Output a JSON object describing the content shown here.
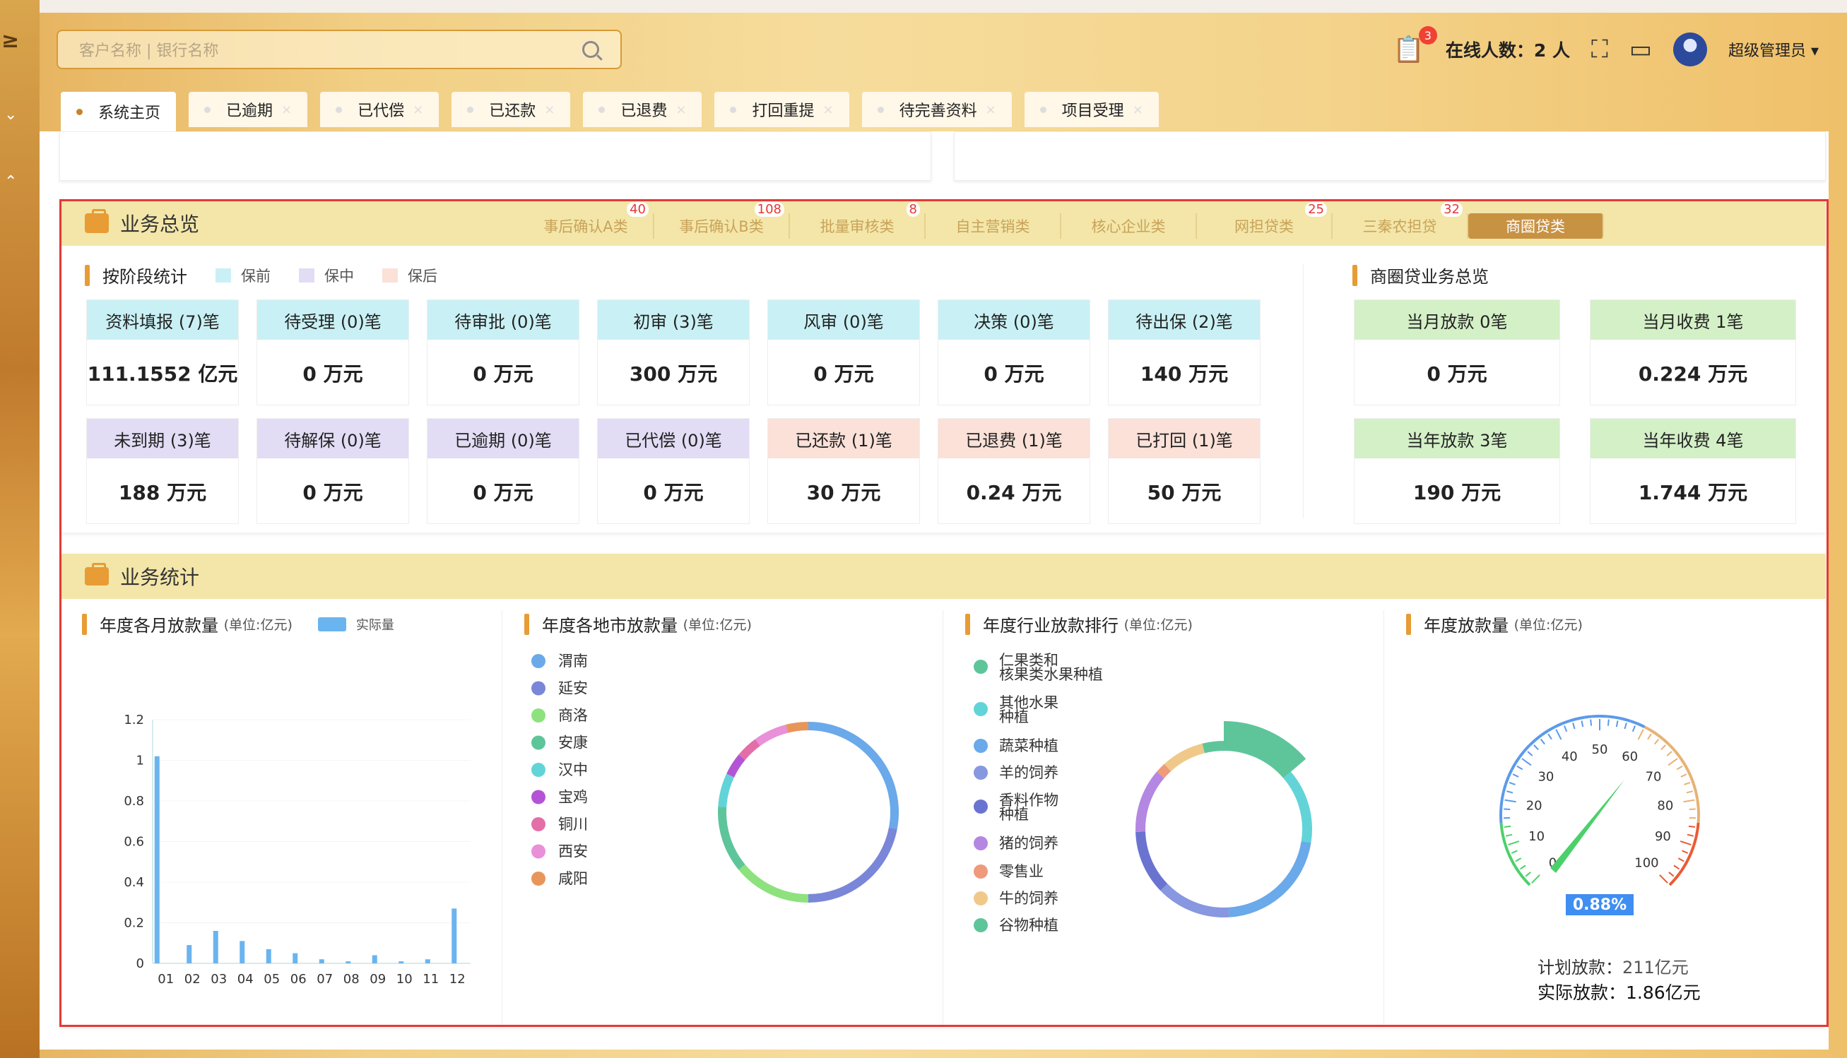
{
  "search": {
    "placeholder": "客户名称 | 银行名称"
  },
  "header": {
    "badge": "3",
    "online": "在线人数：2 人",
    "user": "超级管理员"
  },
  "tabs": [
    "系统主页",
    "已逾期",
    "已代偿",
    "已还款",
    "已退费",
    "打回重提",
    "待完善资料",
    "项目受理"
  ],
  "overview": {
    "title": "业务总览",
    "btabs": [
      {
        "label": "事后确认A类",
        "num": "40"
      },
      {
        "label": "事后确认B类",
        "num": "108"
      },
      {
        "label": "批量审核类",
        "num": "8"
      },
      {
        "label": "自主营销类",
        "num": ""
      },
      {
        "label": "核心企业类",
        "num": ""
      },
      {
        "label": "网担贷类",
        "num": "25"
      },
      {
        "label": "三秦农担贷",
        "num": "32"
      },
      {
        "label": "商圈贷类",
        "num": ""
      }
    ],
    "stage_title": "按阶段统计",
    "legend": [
      {
        "label": "保前",
        "color": "#c9f1f5"
      },
      {
        "label": "保中",
        "color": "#e3dcf5"
      },
      {
        "label": "保后",
        "color": "#fbe1d8"
      }
    ],
    "stage_cards_row1": [
      {
        "t": "资料填报 (7)笔",
        "v": "111.1552 亿元"
      },
      {
        "t": "待受理 (0)笔",
        "v": "0 万元"
      },
      {
        "t": "待审批 (0)笔",
        "v": "0 万元"
      },
      {
        "t": "初审 (3)笔",
        "v": "300 万元"
      },
      {
        "t": "风审 (0)笔",
        "v": "0 万元"
      },
      {
        "t": "决策 (0)笔",
        "v": "0 万元"
      },
      {
        "t": "待出保 (2)笔",
        "v": "140 万元"
      }
    ],
    "stage_cards_row2": [
      {
        "t": "未到期 (3)笔",
        "v": "188 万元"
      },
      {
        "t": "待解保 (0)笔",
        "v": "0 万元"
      },
      {
        "t": "已逾期 (0)笔",
        "v": "0 万元"
      },
      {
        "t": "已代偿 (0)笔",
        "v": "0 万元"
      },
      {
        "t": "已还款 (1)笔",
        "v": "30 万元"
      },
      {
        "t": "已退费 (1)笔",
        "v": "0.24 万元"
      },
      {
        "t": "已打回 (1)笔",
        "v": "50 万元"
      }
    ],
    "mall_title": "商圈贷业务总览",
    "mall_cards": [
      {
        "t": "当月放款 0笔",
        "v": "0 万元"
      },
      {
        "t": "当月收费 1笔",
        "v": "0.224 万元"
      },
      {
        "t": "当年放款 3笔",
        "v": "190 万元"
      },
      {
        "t": "当年收费 4笔",
        "v": "1.744 万元"
      }
    ]
  },
  "stats": {
    "title": "业务统计",
    "c1_title": "年度各月放款量",
    "c2_title": "年度各地市放款量",
    "c3_title": "年度行业放款排行",
    "c4_title": "年度放款量",
    "unit": "(单位:亿元)",
    "planned": "计划放款：",
    "planned_v": "211亿元",
    "actual": "实际放款：",
    "actual_v": "1.86亿元"
  },
  "chart_data": [
    {
      "type": "bar",
      "title": "年度各月放款量",
      "categories": [
        "01",
        "02",
        "03",
        "04",
        "05",
        "06",
        "07",
        "08",
        "09",
        "10",
        "11",
        "12"
      ],
      "series": [
        {
          "name": "实际量",
          "values": [
            1.02,
            0.09,
            0.16,
            0.11,
            0.07,
            0.05,
            0.02,
            0.01,
            0.04,
            0.01,
            0.02,
            0.27
          ]
        }
      ],
      "ylim": [
        0,
        1.2
      ],
      "yticks": [
        "0",
        "0.2",
        "0.4",
        "0.6",
        "0.8",
        "1",
        "1.2"
      ],
      "colors": [
        "#6ab4ef"
      ]
    },
    {
      "type": "pie",
      "title": "年度各地市放款量",
      "categories": [
        "渭南",
        "延安",
        "商洛",
        "安康",
        "汉中",
        "宝鸡",
        "铜川",
        "西安",
        "咸阳"
      ],
      "values": [
        28,
        22,
        14,
        12,
        6,
        4,
        4,
        6,
        4
      ],
      "colors": [
        "#6aa9ea",
        "#7a86d8",
        "#8de27e",
        "#5ec59b",
        "#62d4d8",
        "#b354d7",
        "#e46ea8",
        "#e890d8",
        "#e8955a"
      ]
    },
    {
      "type": "pie",
      "title": "年度行业放款排行",
      "categories": [
        "仁果类和核果类水果种植",
        "其他水果种植",
        "蔬菜种植",
        "羊的饲养",
        "香料作物种植",
        "猪的饲养",
        "零售业",
        "牛的饲养",
        "谷物种植"
      ],
      "values": [
        14,
        14,
        22,
        14,
        12,
        12,
        2,
        8,
        4
      ],
      "colors": [
        "#5ec59b",
        "#62d4d8",
        "#6aa9ea",
        "#8797e0",
        "#6a74d0",
        "#b487e3",
        "#ef9a7a",
        "#f0c98a",
        "#5ec59b"
      ]
    },
    {
      "type": "gauge",
      "title": "年度放款量",
      "value": 0.88,
      "value_label": "0.88%",
      "ticks": [
        "0",
        "10",
        "20",
        "30",
        "40",
        "50",
        "60",
        "70",
        "80",
        "90",
        "100"
      ]
    }
  ]
}
